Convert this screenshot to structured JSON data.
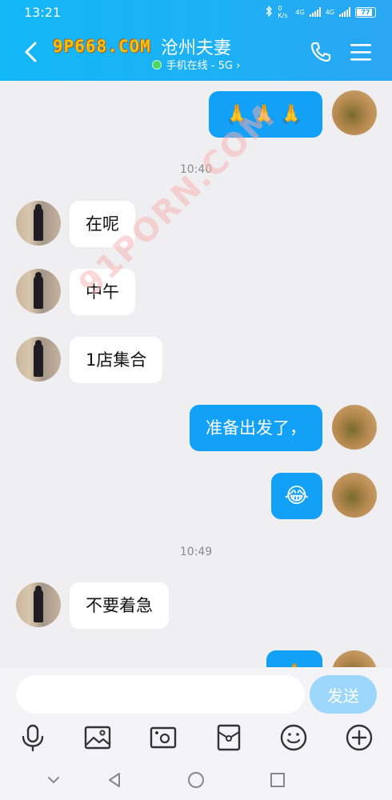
{
  "status_bar": {
    "time": "13:21",
    "speed": "0 K/s",
    "net1": "4G",
    "net2": "4G",
    "battery": "77"
  },
  "header": {
    "title": "沧州夫妻",
    "subtitle": "手机在线 - 5G",
    "watermark": "9P668.COM"
  },
  "overlay_watermark": "91PORN.COM",
  "messages": [
    {
      "side": "out",
      "kind": "emoji",
      "text": "🙏🙏🙏"
    },
    {
      "kind": "time",
      "text": "10:40"
    },
    {
      "side": "in",
      "text": "在呢"
    },
    {
      "side": "in",
      "text": "中午"
    },
    {
      "side": "in",
      "text": "1店集合"
    },
    {
      "side": "out",
      "text": "准备出发了，"
    },
    {
      "side": "out",
      "kind": "emoji",
      "text": "😂"
    },
    {
      "kind": "time",
      "text": "10:49"
    },
    {
      "side": "in",
      "text": "不要着急"
    },
    {
      "side": "out",
      "kind": "emoji",
      "text": "🙏"
    }
  ],
  "input": {
    "placeholder": "",
    "value": "",
    "send_label": "发送"
  },
  "toolbar": [
    "mic-icon",
    "image-icon",
    "camera-icon",
    "red-packet-icon",
    "emoji-icon",
    "plus-icon"
  ],
  "navigation": [
    "down-icon",
    "back-icon",
    "home-icon",
    "recents-icon"
  ],
  "colors": {
    "header": "#1fb0f4",
    "out_bubble": "#13a0f7",
    "in_bubble": "#ffffff",
    "background": "#efeff1",
    "send_button": "#9dd6fb"
  }
}
